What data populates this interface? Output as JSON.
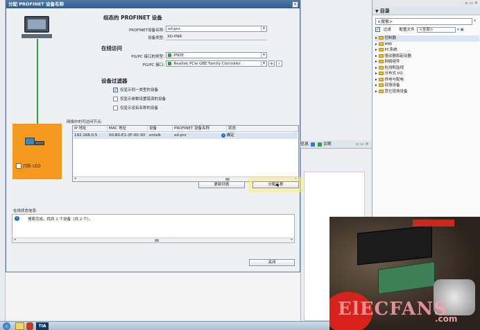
{
  "dialog": {
    "title": "分配 PROFINET 设备名称",
    "configured_section": "组态的 PROFINET 设备",
    "device_name_label": "PROFINET设备名称:",
    "device_name_value": "xd-pnr",
    "device_type_label": "设备类型:",
    "device_type_value": "XD-PNR",
    "online_section": "在线访问",
    "pgpc_type_label": "PG/PC 接口的类型:",
    "pgpc_type_value": "PN/IE",
    "pgpc_if_label": "PG/PC 接口:",
    "pgpc_if_value": "Realtek PCIe GBE Family Controller",
    "filter_section": "设备过滤器",
    "filters": [
      {
        "label": "仅显示同一类型的设备",
        "checked": true
      },
      {
        "label": "仅显示参数设置错误的设备",
        "checked": false
      },
      {
        "label": "仅显示没有名称的设备",
        "checked": false
      }
    ],
    "nodes_label": "网络中的可访问节点:",
    "columns": [
      "IP 地址",
      "MAC 地址",
      "设备",
      "PROFINET 设备名称",
      "状态"
    ],
    "rows": [
      {
        "ip": "192.168.0.5",
        "mac": "00-B0-E1-3F-00-3D",
        "device": "entalk",
        "name": "xd-pnr",
        "status": "确定"
      }
    ],
    "refresh_button": "更新列表",
    "assign_button": "分配名称",
    "led_label": "闪烁 LED",
    "status_label": "在线状态信息:",
    "status_message": "搜索完成。找到 1 个设备（共 2 个）。",
    "close_button": "关闭"
  },
  "catalog": {
    "title": "目录",
    "search_placeholder": "<搜索>",
    "filter_label": "过滤",
    "profile_label": "配置文件",
    "profile_value": "<全部>",
    "items": [
      "控制器",
      "HMI",
      "PC系统",
      "驱动器和起动器",
      "网络组件",
      "检测和监视",
      "分布式 I/O",
      "供电与配电",
      "现场设备",
      "其它现场设备"
    ]
  },
  "bg": {
    "tab_info": "信息",
    "tab_diag": "诊断"
  },
  "taskbar": {
    "tia_label": "TIA"
  },
  "watermark": {
    "logo": "ElECFANS",
    "domain": ".com"
  }
}
